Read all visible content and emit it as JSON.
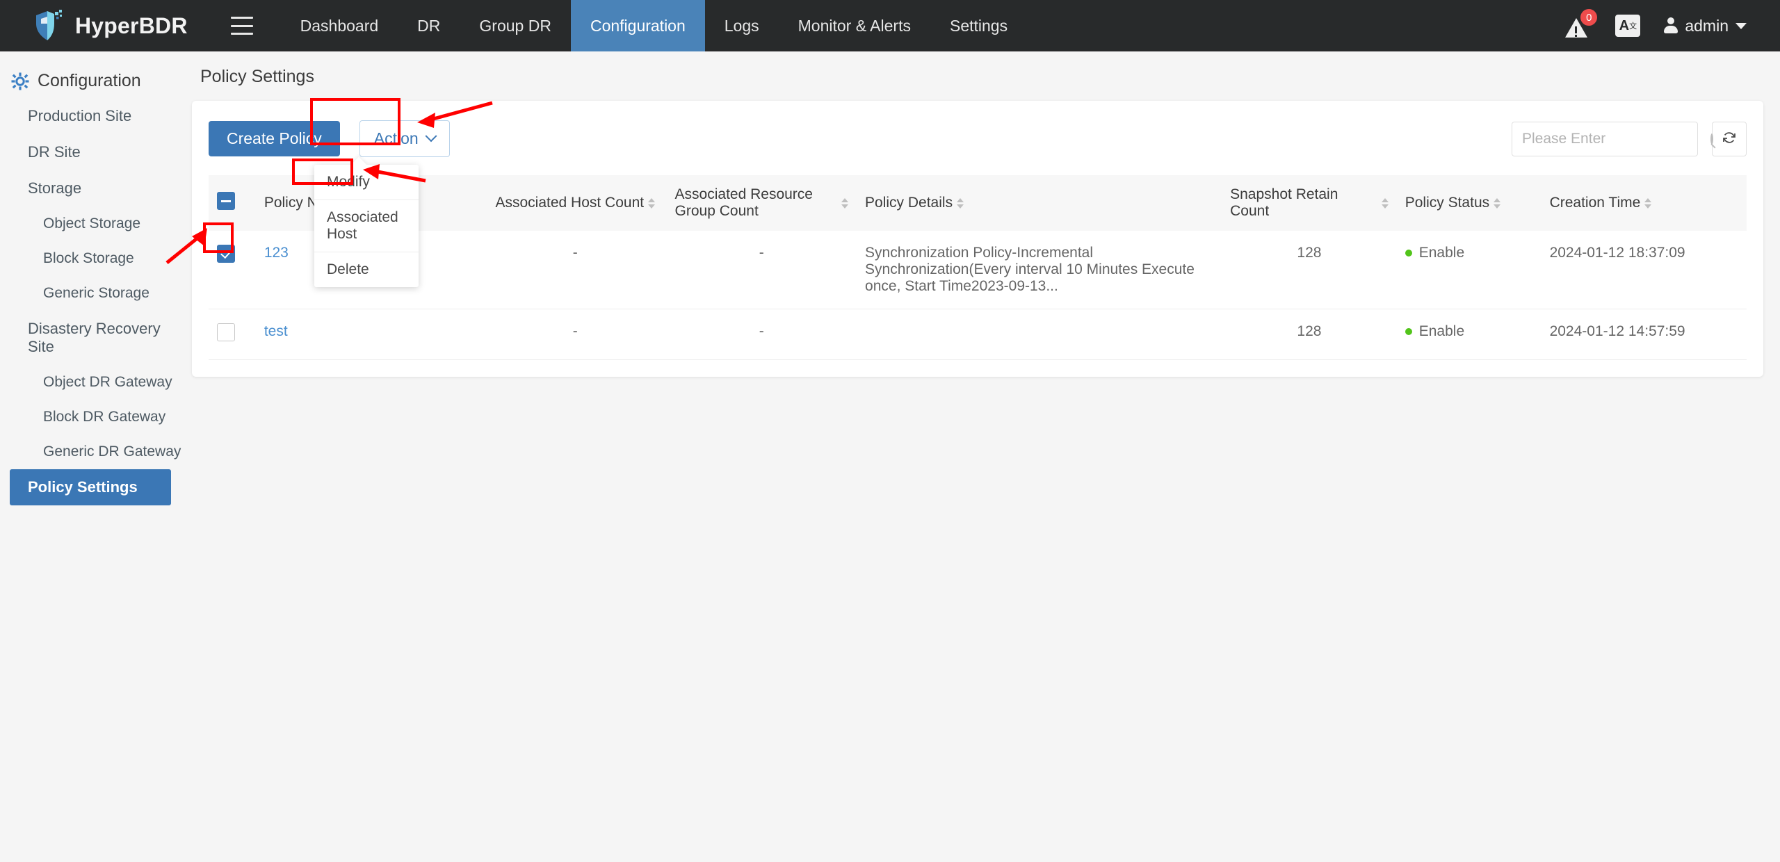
{
  "app": {
    "brand": "HyperBDR",
    "logo_icon": "shield-logo-icon",
    "menu_icon": "hamburger-menu-icon"
  },
  "topnav": {
    "items": [
      {
        "label": "Dashboard",
        "active": false
      },
      {
        "label": "DR",
        "active": false
      },
      {
        "label": "Group DR",
        "active": false
      },
      {
        "label": "Configuration",
        "active": true
      },
      {
        "label": "Logs",
        "active": false
      },
      {
        "label": "Monitor & Alerts",
        "active": false
      },
      {
        "label": "Settings",
        "active": false
      }
    ],
    "alert_badge_count": "0",
    "alert_icon": "warning-triangle-icon",
    "language_icon": "translate-icon",
    "language_label": "A",
    "language_sup": "文",
    "user_icon": "user-avatar-icon",
    "user_name": "admin",
    "caret_icon": "chevron-down-icon"
  },
  "sidebar": {
    "heading": "Configuration",
    "heading_icon": "gear-icon",
    "items": [
      {
        "label": "Production Site",
        "level": 1,
        "active": false
      },
      {
        "label": "DR Site",
        "level": 1,
        "active": false
      },
      {
        "label": "Storage",
        "level": 1,
        "active": false
      },
      {
        "label": "Object Storage",
        "level": 2,
        "active": false
      },
      {
        "label": "Block Storage",
        "level": 2,
        "active": false
      },
      {
        "label": "Generic Storage",
        "level": 2,
        "active": false
      },
      {
        "label": "Disastery Recovery Site",
        "level": 1,
        "active": false
      },
      {
        "label": "Object DR Gateway",
        "level": 2,
        "active": false
      },
      {
        "label": "Block DR Gateway",
        "level": 2,
        "active": false
      },
      {
        "label": "Generic DR Gateway",
        "level": 2,
        "active": false
      },
      {
        "label": "Policy Settings",
        "level": 1,
        "active": true
      }
    ]
  },
  "main": {
    "page_title": "Policy Settings",
    "toolbar": {
      "create_label": "Create Policy",
      "action_label": "Action",
      "action_caret_icon": "chevron-down-icon",
      "search_placeholder": "Please Enter",
      "search_value": "",
      "search_icon": "search-icon",
      "refresh_icon": "refresh-icon"
    },
    "action_menu": {
      "open": true,
      "items": [
        {
          "label": "Modify",
          "highlighted": true
        },
        {
          "label": "Associated Host",
          "highlighted": false
        },
        {
          "label": "Delete",
          "highlighted": false
        }
      ]
    },
    "table": {
      "select_all_state": "indeterminate",
      "columns": [
        {
          "key": "name",
          "label": "Policy Name",
          "sortable": true
        },
        {
          "key": "hosts",
          "label": "Associated Host Count",
          "sortable": true
        },
        {
          "key": "groups",
          "label": "Associated Resource Group Count",
          "sortable": true
        },
        {
          "key": "detail",
          "label": "Policy Details",
          "sortable": true
        },
        {
          "key": "retain",
          "label": "Snapshot Retain Count",
          "sortable": true
        },
        {
          "key": "status",
          "label": "Policy Status",
          "sortable": true
        },
        {
          "key": "created",
          "label": "Creation Time",
          "sortable": true
        }
      ],
      "rows": [
        {
          "selected": true,
          "name": "123",
          "hosts": "-",
          "groups": "-",
          "detail": "Synchronization Policy-Incremental Synchronization(Every interval 10 Minutes Execute once, Start Time2023-09-13...",
          "retain": "128",
          "status": "Enable",
          "created": "2024-01-12 18:37:09"
        },
        {
          "selected": false,
          "name": "test",
          "hosts": "-",
          "groups": "-",
          "detail": "",
          "retain": "128",
          "status": "Enable",
          "created": "2024-01-12 14:57:59"
        }
      ]
    }
  },
  "colors": {
    "accent_blue": "#3b77b5",
    "nav_dark": "#282a2b",
    "nav_active": "#4a83b8",
    "status_green": "#52c41a",
    "annotation_red": "#ff0000",
    "link_blue": "#4a8fd0",
    "badge_red": "#ee4c4c"
  }
}
